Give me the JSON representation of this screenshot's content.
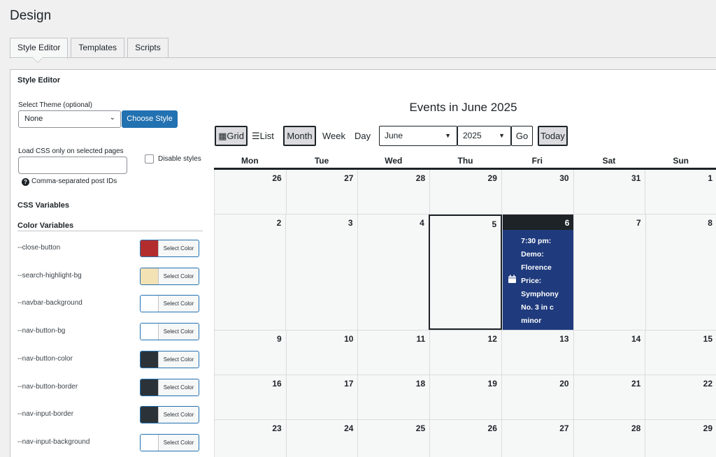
{
  "page": {
    "title": "Design"
  },
  "tabs": [
    {
      "label": "Style Editor",
      "active": true
    },
    {
      "label": "Templates",
      "active": false
    },
    {
      "label": "Scripts",
      "active": false
    }
  ],
  "sidebar": {
    "heading": "Style Editor",
    "theme_label": "Select Theme (optional)",
    "theme_value": "None",
    "choose_style_label": "Choose Style",
    "load_css_label": "Load CSS only on selected pages",
    "load_css_value": "",
    "disable_styles_label": "Disable styles",
    "disable_styles_checked": false,
    "help_text": "Comma-separated post IDs",
    "css_vars_heading": "CSS Variables",
    "color_vars_heading": "Color Variables",
    "select_color_label": "Select Color",
    "color_variables": [
      {
        "name": "--close-button",
        "color": "#b32d2e"
      },
      {
        "name": "--search-highlight-bg",
        "color": "#f3e2b4"
      },
      {
        "name": "--navbar-background",
        "color": "#ffffff"
      },
      {
        "name": "--nav-button-bg",
        "color": "#ffffff"
      },
      {
        "name": "--nav-button-color",
        "color": "#2c3338"
      },
      {
        "name": "--nav-button-border",
        "color": "#2c3338"
      },
      {
        "name": "--nav-input-border",
        "color": "#2c3338"
      },
      {
        "name": "--nav-input-background",
        "color": "#ffffff"
      }
    ]
  },
  "calendar": {
    "title": "Events in June 2025",
    "nav": {
      "grid_label": "Grid",
      "list_label": "List",
      "month_label": "Month",
      "week_label": "Week",
      "day_label": "Day",
      "month_select": "June",
      "year_select": "2025",
      "go_label": "Go",
      "today_label": "Today"
    },
    "weekdays": [
      "Mon",
      "Tue",
      "Wed",
      "Thu",
      "Fri",
      "Sat",
      "Sun"
    ],
    "weeks": [
      [
        "26",
        "27",
        "28",
        "29",
        "30",
        "31",
        "1"
      ],
      [
        "2",
        "3",
        "4",
        "5",
        "6",
        "7",
        "8"
      ],
      [
        "9",
        "10",
        "11",
        "12",
        "13",
        "14",
        "15"
      ],
      [
        "16",
        "17",
        "18",
        "19",
        "20",
        "21",
        "22"
      ],
      [
        "23",
        "24",
        "25",
        "26",
        "27",
        "28",
        "29"
      ]
    ],
    "today": "5",
    "event_day": "6",
    "event_lines": [
      "7:30 pm:",
      "Demo:",
      "Florence",
      "Price:",
      "Symphony",
      "No. 3 in c",
      "minor"
    ],
    "colors": {
      "event_bg": "#1f3b7d",
      "event_header": "#1d2327"
    }
  }
}
